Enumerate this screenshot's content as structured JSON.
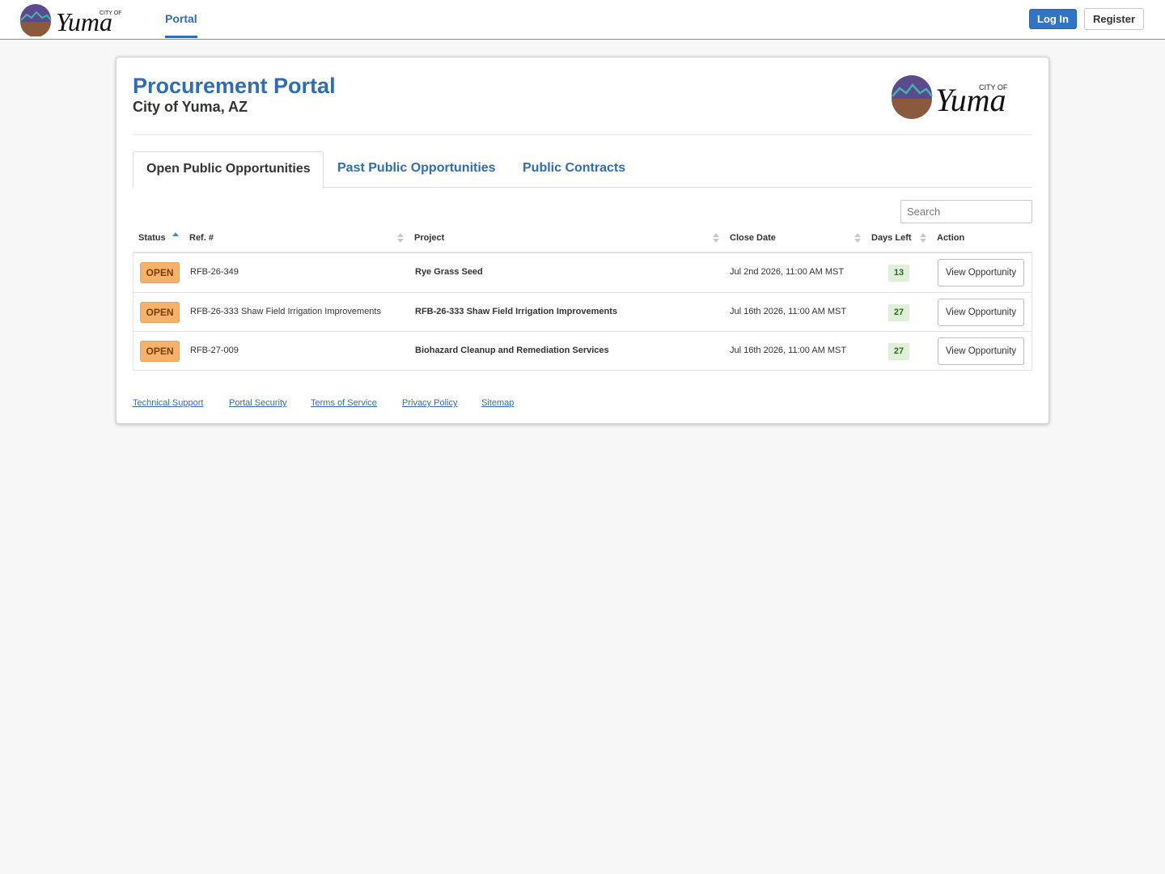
{
  "nav": {
    "logo_alt": "City of Yuma",
    "logo_city_of": "CITY OF",
    "logo_name": "Yuma",
    "portal_link": "Portal",
    "login_label": "Log In",
    "register_label": "Register"
  },
  "header": {
    "title": "Procurement Portal",
    "subtitle": "City of Yuma, AZ"
  },
  "tabs": [
    {
      "label": "Open Public Opportunities",
      "active": true
    },
    {
      "label": "Past Public Opportunities",
      "active": false
    },
    {
      "label": "Public Contracts",
      "active": false
    }
  ],
  "search": {
    "placeholder": "Search"
  },
  "table": {
    "columns": [
      "Status",
      "Ref. #",
      "Project",
      "Close Date",
      "Days Left",
      "Action"
    ],
    "rows": [
      {
        "status": "OPEN",
        "ref": "RFB-26-349",
        "project": "Rye Grass Seed",
        "close_date": "Jul 2nd 2026, 11:00 AM MST",
        "days_left": "13",
        "action": "View Opportunity"
      },
      {
        "status": "OPEN",
        "ref": "RFB-26-333 Shaw Field Irrigation Improvements",
        "project": "RFB-26-333 Shaw Field Irrigation Improvements",
        "close_date": "Jul 16th 2026, 11:00 AM MST",
        "days_left": "27",
        "action": "View Opportunity"
      },
      {
        "status": "OPEN",
        "ref": "RFB-27-009",
        "project": "Biohazard Cleanup and Remediation Services",
        "close_date": "Jul 16th 2026, 11:00 AM MST",
        "days_left": "27",
        "action": "View Opportunity"
      }
    ]
  },
  "footer": {
    "links": [
      "Technical Support",
      "Portal Security",
      "Terms of Service",
      "Privacy Policy",
      "Sitemap"
    ]
  },
  "colors": {
    "brand_blue": "#2f6eb5",
    "status_open": "#f6b26b",
    "days_left_bg": "#dff0d8"
  }
}
